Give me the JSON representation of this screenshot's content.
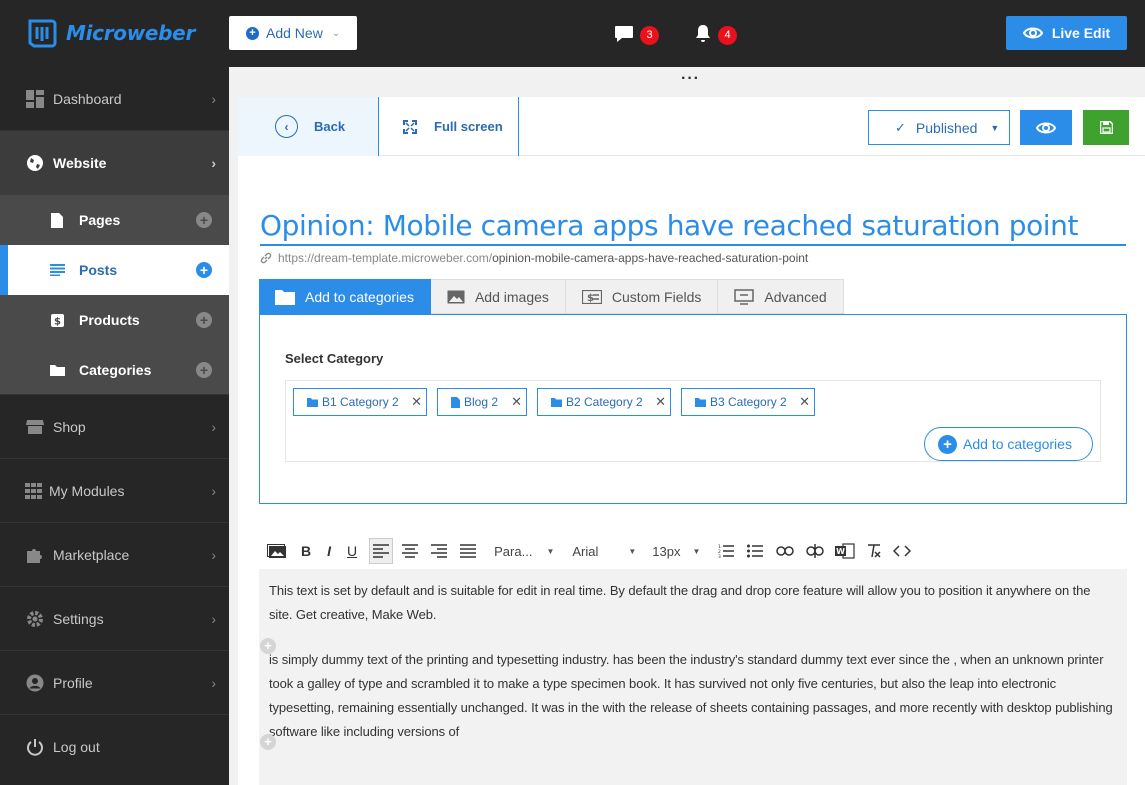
{
  "topbar": {
    "brand": "Microweber",
    "add_new": "Add New",
    "comments_count": "3",
    "notifications_count": "4",
    "live_edit": "Live Edit"
  },
  "sidebar": {
    "items": [
      {
        "label": "Dashboard"
      },
      {
        "label": "Website"
      },
      {
        "label": "Shop"
      },
      {
        "label": "My Modules"
      },
      {
        "label": "Marketplace"
      },
      {
        "label": "Settings"
      },
      {
        "label": "Profile"
      },
      {
        "label": "Log out"
      }
    ],
    "website_sub": [
      {
        "label": "Pages"
      },
      {
        "label": "Posts"
      },
      {
        "label": "Products"
      },
      {
        "label": "Categories"
      }
    ]
  },
  "toolbar": {
    "back": "Back",
    "full_screen": "Full screen",
    "status": "Published"
  },
  "post": {
    "title": "Opinion: Mobile camera apps have reached saturation point",
    "url_base": "https://dream-template.microweber.com/",
    "url_slug": "opinion-mobile-camera-apps-have-reached-saturation-point"
  },
  "tabs": [
    {
      "label": "Add to categories"
    },
    {
      "label": "Add images"
    },
    {
      "label": "Custom Fields"
    },
    {
      "label": "Advanced"
    }
  ],
  "categories": {
    "heading": "Select Category",
    "chips": [
      {
        "label": "B1 Category 2",
        "type": "folder"
      },
      {
        "label": "Blog 2",
        "type": "page"
      },
      {
        "label": "B2 Category 2",
        "type": "folder"
      },
      {
        "label": "B3 Category 2",
        "type": "folder"
      }
    ],
    "add_button": "Add to categories"
  },
  "editor": {
    "format": "Para...",
    "font": "Arial",
    "size": "13px",
    "paragraph1": "This text is set by default and is suitable for edit in real time. By default the drag and drop core feature will allow you to position it anywhere on the site. Get creative, Make Web.",
    "paragraph2": "is simply dummy text of the printing and typesetting industry. has been the industry's standard dummy text ever since the , when an unknown printer took a galley of type and scrambled it to make a type specimen book. It has survived not only five centuries, but also the leap into electronic typesetting, remaining essentially unchanged. It was  in the  with the release of  sheets containing  passages, and more recently with desktop publishing software like  including versions of"
  },
  "colors": {
    "accent": "#2b8de8",
    "sidebar_bg": "#262626",
    "save_green": "#3fa12e",
    "badge_red": "#e8111c"
  }
}
